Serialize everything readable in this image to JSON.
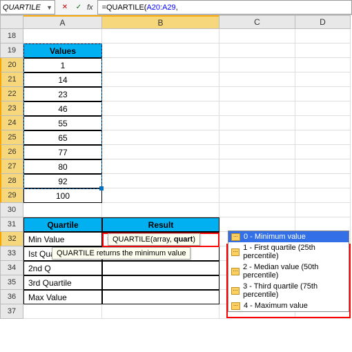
{
  "nameBox": "QUARTILE",
  "formulaBar": {
    "prefix": "=QUARTILE(",
    "ref": "A20:A29",
    "suffix": ","
  },
  "columns": [
    "A",
    "B",
    "C",
    "D"
  ],
  "rowsVisible": [
    18,
    19,
    20,
    21,
    22,
    23,
    24,
    25,
    26,
    27,
    28,
    29,
    30,
    31,
    32,
    33,
    34,
    35,
    36,
    37
  ],
  "valuesHeader": "Values",
  "values": [
    1,
    14,
    23,
    46,
    55,
    65,
    77,
    80,
    92,
    100
  ],
  "quartHeader1": "Quartile",
  "quartHeader2": "Result",
  "quartLabels": [
    "Min Value",
    "Ist Quartile",
    "2nd Q",
    "3rd Quartile",
    "Max Value"
  ],
  "activeFormula": {
    "prefix": "=QUARTILE(",
    "ref": "A20:A29",
    "suffix": ","
  },
  "tooltipArgs": {
    "fn": "QUARTILE",
    "args": "(array, ",
    "boldArg": "quart",
    "close": ")"
  },
  "tooltipReturn": "QUARTILE returns the minimum value",
  "suggestions": [
    {
      "v": "0",
      "t": " - Minimum value",
      "sel": true
    },
    {
      "v": "1",
      "t": " - First quartile (25th percentile)",
      "sel": false
    },
    {
      "v": "2",
      "t": " - Median value (50th percentile)",
      "sel": false
    },
    {
      "v": "3",
      "t": " - Third quartile (75th percentile)",
      "sel": false
    },
    {
      "v": "4",
      "t": " - Maximum value",
      "sel": false
    }
  ]
}
